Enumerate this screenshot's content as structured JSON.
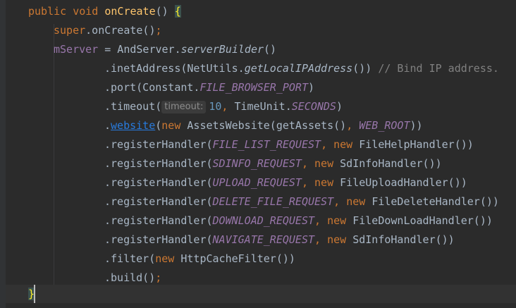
{
  "editor": {
    "lines": [
      {
        "id": "l1",
        "tokens": [
          {
            "t": "public ",
            "c": "kw"
          },
          {
            "t": "void ",
            "c": "kw"
          },
          {
            "t": "onCreate",
            "c": "mth"
          },
          {
            "t": "() ",
            "c": ""
          },
          {
            "t": "{",
            "c": "brace-hl"
          }
        ]
      },
      {
        "id": "l2",
        "tokens": [
          {
            "t": "super",
            "c": "kw"
          },
          {
            "t": ".onCreate()",
            "c": ""
          },
          {
            "t": ";",
            "c": "kw"
          }
        ]
      },
      {
        "id": "l3",
        "tokens": [
          {
            "t": "mServer",
            "c": "fld"
          },
          {
            "t": " = AndServer.",
            "c": ""
          },
          {
            "t": "serverBuilder",
            "c": "ital"
          },
          {
            "t": "()",
            "c": ""
          }
        ]
      },
      {
        "id": "l4",
        "tokens": [
          {
            "t": ".inetAddress(NetUtils.",
            "c": ""
          },
          {
            "t": "getLocalIPAddress",
            "c": "ital"
          },
          {
            "t": "()) ",
            "c": ""
          },
          {
            "t": "// Bind IP address.",
            "c": "cmt"
          }
        ]
      },
      {
        "id": "l5",
        "tokens": [
          {
            "t": ".port(Constant.",
            "c": ""
          },
          {
            "t": "FILE_BROWSER_PORT",
            "c": "fldi"
          },
          {
            "t": ")",
            "c": ""
          }
        ]
      },
      {
        "id": "l6",
        "tokens": [
          {
            "t": ".timeout(",
            "c": ""
          },
          {
            "t": "timeout:",
            "c": "hint"
          },
          {
            "t": "10",
            "c": "num"
          },
          {
            "t": ", ",
            "c": "kw"
          },
          {
            "t": "TimeUnit.",
            "c": ""
          },
          {
            "t": "SECONDS",
            "c": "fldi"
          },
          {
            "t": ")",
            "c": ""
          }
        ]
      },
      {
        "id": "l7",
        "tokens": [
          {
            "t": ".",
            "c": ""
          },
          {
            "t": "website",
            "c": "lnk"
          },
          {
            "t": "(",
            "c": ""
          },
          {
            "t": "new ",
            "c": "kw"
          },
          {
            "t": "AssetsWebsite(getAssets()",
            "c": ""
          },
          {
            "t": ", ",
            "c": "kw"
          },
          {
            "t": "WEB_ROOT",
            "c": "fldi"
          },
          {
            "t": "))",
            "c": ""
          }
        ]
      },
      {
        "id": "l8",
        "tokens": [
          {
            "t": ".registerHandler(",
            "c": ""
          },
          {
            "t": "FILE_LIST_REQUEST",
            "c": "fldi"
          },
          {
            "t": ", ",
            "c": "kw"
          },
          {
            "t": "new ",
            "c": "kw"
          },
          {
            "t": "FileHelpHandler())",
            "c": ""
          }
        ]
      },
      {
        "id": "l9",
        "tokens": [
          {
            "t": ".registerHandler(",
            "c": ""
          },
          {
            "t": "SDINFO_REQUEST",
            "c": "fldi"
          },
          {
            "t": ", ",
            "c": "kw"
          },
          {
            "t": "new ",
            "c": "kw"
          },
          {
            "t": "SdInfoHandler())",
            "c": ""
          }
        ]
      },
      {
        "id": "l10",
        "tokens": [
          {
            "t": ".registerHandler(",
            "c": ""
          },
          {
            "t": "UPLOAD_REQUEST",
            "c": "fldi"
          },
          {
            "t": ", ",
            "c": "kw"
          },
          {
            "t": "new ",
            "c": "kw"
          },
          {
            "t": "FileUploadHandler())",
            "c": ""
          }
        ]
      },
      {
        "id": "l11",
        "tokens": [
          {
            "t": ".registerHandler(",
            "c": ""
          },
          {
            "t": "DELETE_FILE_REQUEST",
            "c": "fldi"
          },
          {
            "t": ", ",
            "c": "kw"
          },
          {
            "t": "new ",
            "c": "kw"
          },
          {
            "t": "FileDeleteHandler())",
            "c": ""
          }
        ]
      },
      {
        "id": "l12",
        "tokens": [
          {
            "t": ".registerHandler(",
            "c": ""
          },
          {
            "t": "DOWNLOAD_REQUEST",
            "c": "fldi"
          },
          {
            "t": ", ",
            "c": "kw"
          },
          {
            "t": "new ",
            "c": "kw"
          },
          {
            "t": "FileDownLoadHandler())",
            "c": ""
          }
        ]
      },
      {
        "id": "l13",
        "tokens": [
          {
            "t": ".registerHandler(",
            "c": ""
          },
          {
            "t": "NAVIGATE_REQUEST",
            "c": "fldi"
          },
          {
            "t": ", ",
            "c": "kw"
          },
          {
            "t": "new ",
            "c": "kw"
          },
          {
            "t": "SdInfoHandler())",
            "c": ""
          }
        ]
      },
      {
        "id": "l14",
        "tokens": [
          {
            "t": ".filter(",
            "c": ""
          },
          {
            "t": "new ",
            "c": "kw"
          },
          {
            "t": "HttpCacheFilter())",
            "c": ""
          }
        ]
      },
      {
        "id": "l15",
        "tokens": [
          {
            "t": ".build()",
            "c": ""
          },
          {
            "t": ";",
            "c": "kw"
          }
        ]
      },
      {
        "id": "l16",
        "tokens": [
          {
            "t": "}",
            "c": "brace-hl"
          }
        ]
      }
    ]
  },
  "colors": {
    "background": "#2b2b2b",
    "keyword": "#cc7832",
    "method": "#ffc66d",
    "field": "#9876aa",
    "comment": "#808080",
    "number": "#6897bb",
    "text": "#a9b7c6"
  }
}
